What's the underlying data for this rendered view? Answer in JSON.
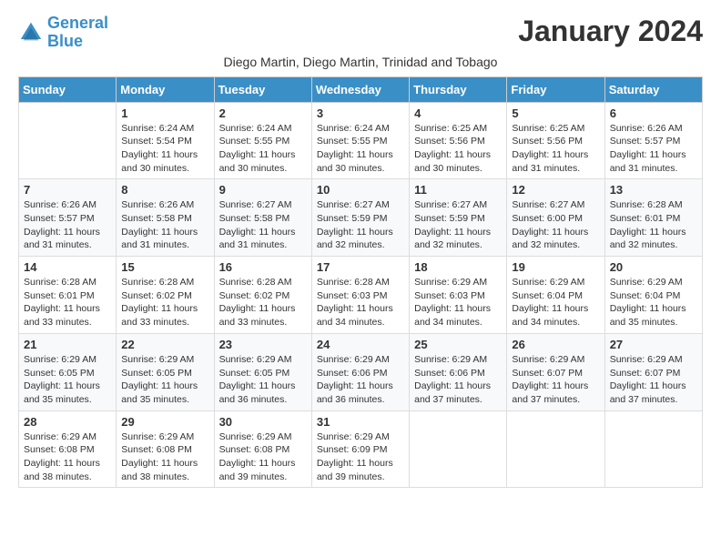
{
  "header": {
    "logo_line1": "General",
    "logo_line2": "Blue",
    "month_title": "January 2024",
    "location": "Diego Martin, Diego Martin, Trinidad and Tobago"
  },
  "weekdays": [
    "Sunday",
    "Monday",
    "Tuesday",
    "Wednesday",
    "Thursday",
    "Friday",
    "Saturday"
  ],
  "weeks": [
    [
      {
        "day": "",
        "sunrise": "",
        "sunset": "",
        "daylight": ""
      },
      {
        "day": "1",
        "sunrise": "Sunrise: 6:24 AM",
        "sunset": "Sunset: 5:54 PM",
        "daylight": "Daylight: 11 hours and 30 minutes."
      },
      {
        "day": "2",
        "sunrise": "Sunrise: 6:24 AM",
        "sunset": "Sunset: 5:55 PM",
        "daylight": "Daylight: 11 hours and 30 minutes."
      },
      {
        "day": "3",
        "sunrise": "Sunrise: 6:24 AM",
        "sunset": "Sunset: 5:55 PM",
        "daylight": "Daylight: 11 hours and 30 minutes."
      },
      {
        "day": "4",
        "sunrise": "Sunrise: 6:25 AM",
        "sunset": "Sunset: 5:56 PM",
        "daylight": "Daylight: 11 hours and 30 minutes."
      },
      {
        "day": "5",
        "sunrise": "Sunrise: 6:25 AM",
        "sunset": "Sunset: 5:56 PM",
        "daylight": "Daylight: 11 hours and 31 minutes."
      },
      {
        "day": "6",
        "sunrise": "Sunrise: 6:26 AM",
        "sunset": "Sunset: 5:57 PM",
        "daylight": "Daylight: 11 hours and 31 minutes."
      }
    ],
    [
      {
        "day": "7",
        "sunrise": "Sunrise: 6:26 AM",
        "sunset": "Sunset: 5:57 PM",
        "daylight": "Daylight: 11 hours and 31 minutes."
      },
      {
        "day": "8",
        "sunrise": "Sunrise: 6:26 AM",
        "sunset": "Sunset: 5:58 PM",
        "daylight": "Daylight: 11 hours and 31 minutes."
      },
      {
        "day": "9",
        "sunrise": "Sunrise: 6:27 AM",
        "sunset": "Sunset: 5:58 PM",
        "daylight": "Daylight: 11 hours and 31 minutes."
      },
      {
        "day": "10",
        "sunrise": "Sunrise: 6:27 AM",
        "sunset": "Sunset: 5:59 PM",
        "daylight": "Daylight: 11 hours and 32 minutes."
      },
      {
        "day": "11",
        "sunrise": "Sunrise: 6:27 AM",
        "sunset": "Sunset: 5:59 PM",
        "daylight": "Daylight: 11 hours and 32 minutes."
      },
      {
        "day": "12",
        "sunrise": "Sunrise: 6:27 AM",
        "sunset": "Sunset: 6:00 PM",
        "daylight": "Daylight: 11 hours and 32 minutes."
      },
      {
        "day": "13",
        "sunrise": "Sunrise: 6:28 AM",
        "sunset": "Sunset: 6:01 PM",
        "daylight": "Daylight: 11 hours and 32 minutes."
      }
    ],
    [
      {
        "day": "14",
        "sunrise": "Sunrise: 6:28 AM",
        "sunset": "Sunset: 6:01 PM",
        "daylight": "Daylight: 11 hours and 33 minutes."
      },
      {
        "day": "15",
        "sunrise": "Sunrise: 6:28 AM",
        "sunset": "Sunset: 6:02 PM",
        "daylight": "Daylight: 11 hours and 33 minutes."
      },
      {
        "day": "16",
        "sunrise": "Sunrise: 6:28 AM",
        "sunset": "Sunset: 6:02 PM",
        "daylight": "Daylight: 11 hours and 33 minutes."
      },
      {
        "day": "17",
        "sunrise": "Sunrise: 6:28 AM",
        "sunset": "Sunset: 6:03 PM",
        "daylight": "Daylight: 11 hours and 34 minutes."
      },
      {
        "day": "18",
        "sunrise": "Sunrise: 6:29 AM",
        "sunset": "Sunset: 6:03 PM",
        "daylight": "Daylight: 11 hours and 34 minutes."
      },
      {
        "day": "19",
        "sunrise": "Sunrise: 6:29 AM",
        "sunset": "Sunset: 6:04 PM",
        "daylight": "Daylight: 11 hours and 34 minutes."
      },
      {
        "day": "20",
        "sunrise": "Sunrise: 6:29 AM",
        "sunset": "Sunset: 6:04 PM",
        "daylight": "Daylight: 11 hours and 35 minutes."
      }
    ],
    [
      {
        "day": "21",
        "sunrise": "Sunrise: 6:29 AM",
        "sunset": "Sunset: 6:05 PM",
        "daylight": "Daylight: 11 hours and 35 minutes."
      },
      {
        "day": "22",
        "sunrise": "Sunrise: 6:29 AM",
        "sunset": "Sunset: 6:05 PM",
        "daylight": "Daylight: 11 hours and 35 minutes."
      },
      {
        "day": "23",
        "sunrise": "Sunrise: 6:29 AM",
        "sunset": "Sunset: 6:05 PM",
        "daylight": "Daylight: 11 hours and 36 minutes."
      },
      {
        "day": "24",
        "sunrise": "Sunrise: 6:29 AM",
        "sunset": "Sunset: 6:06 PM",
        "daylight": "Daylight: 11 hours and 36 minutes."
      },
      {
        "day": "25",
        "sunrise": "Sunrise: 6:29 AM",
        "sunset": "Sunset: 6:06 PM",
        "daylight": "Daylight: 11 hours and 37 minutes."
      },
      {
        "day": "26",
        "sunrise": "Sunrise: 6:29 AM",
        "sunset": "Sunset: 6:07 PM",
        "daylight": "Daylight: 11 hours and 37 minutes."
      },
      {
        "day": "27",
        "sunrise": "Sunrise: 6:29 AM",
        "sunset": "Sunset: 6:07 PM",
        "daylight": "Daylight: 11 hours and 37 minutes."
      }
    ],
    [
      {
        "day": "28",
        "sunrise": "Sunrise: 6:29 AM",
        "sunset": "Sunset: 6:08 PM",
        "daylight": "Daylight: 11 hours and 38 minutes."
      },
      {
        "day": "29",
        "sunrise": "Sunrise: 6:29 AM",
        "sunset": "Sunset: 6:08 PM",
        "daylight": "Daylight: 11 hours and 38 minutes."
      },
      {
        "day": "30",
        "sunrise": "Sunrise: 6:29 AM",
        "sunset": "Sunset: 6:08 PM",
        "daylight": "Daylight: 11 hours and 39 minutes."
      },
      {
        "day": "31",
        "sunrise": "Sunrise: 6:29 AM",
        "sunset": "Sunset: 6:09 PM",
        "daylight": "Daylight: 11 hours and 39 minutes."
      },
      {
        "day": "",
        "sunrise": "",
        "sunset": "",
        "daylight": ""
      },
      {
        "day": "",
        "sunrise": "",
        "sunset": "",
        "daylight": ""
      },
      {
        "day": "",
        "sunrise": "",
        "sunset": "",
        "daylight": ""
      }
    ]
  ]
}
